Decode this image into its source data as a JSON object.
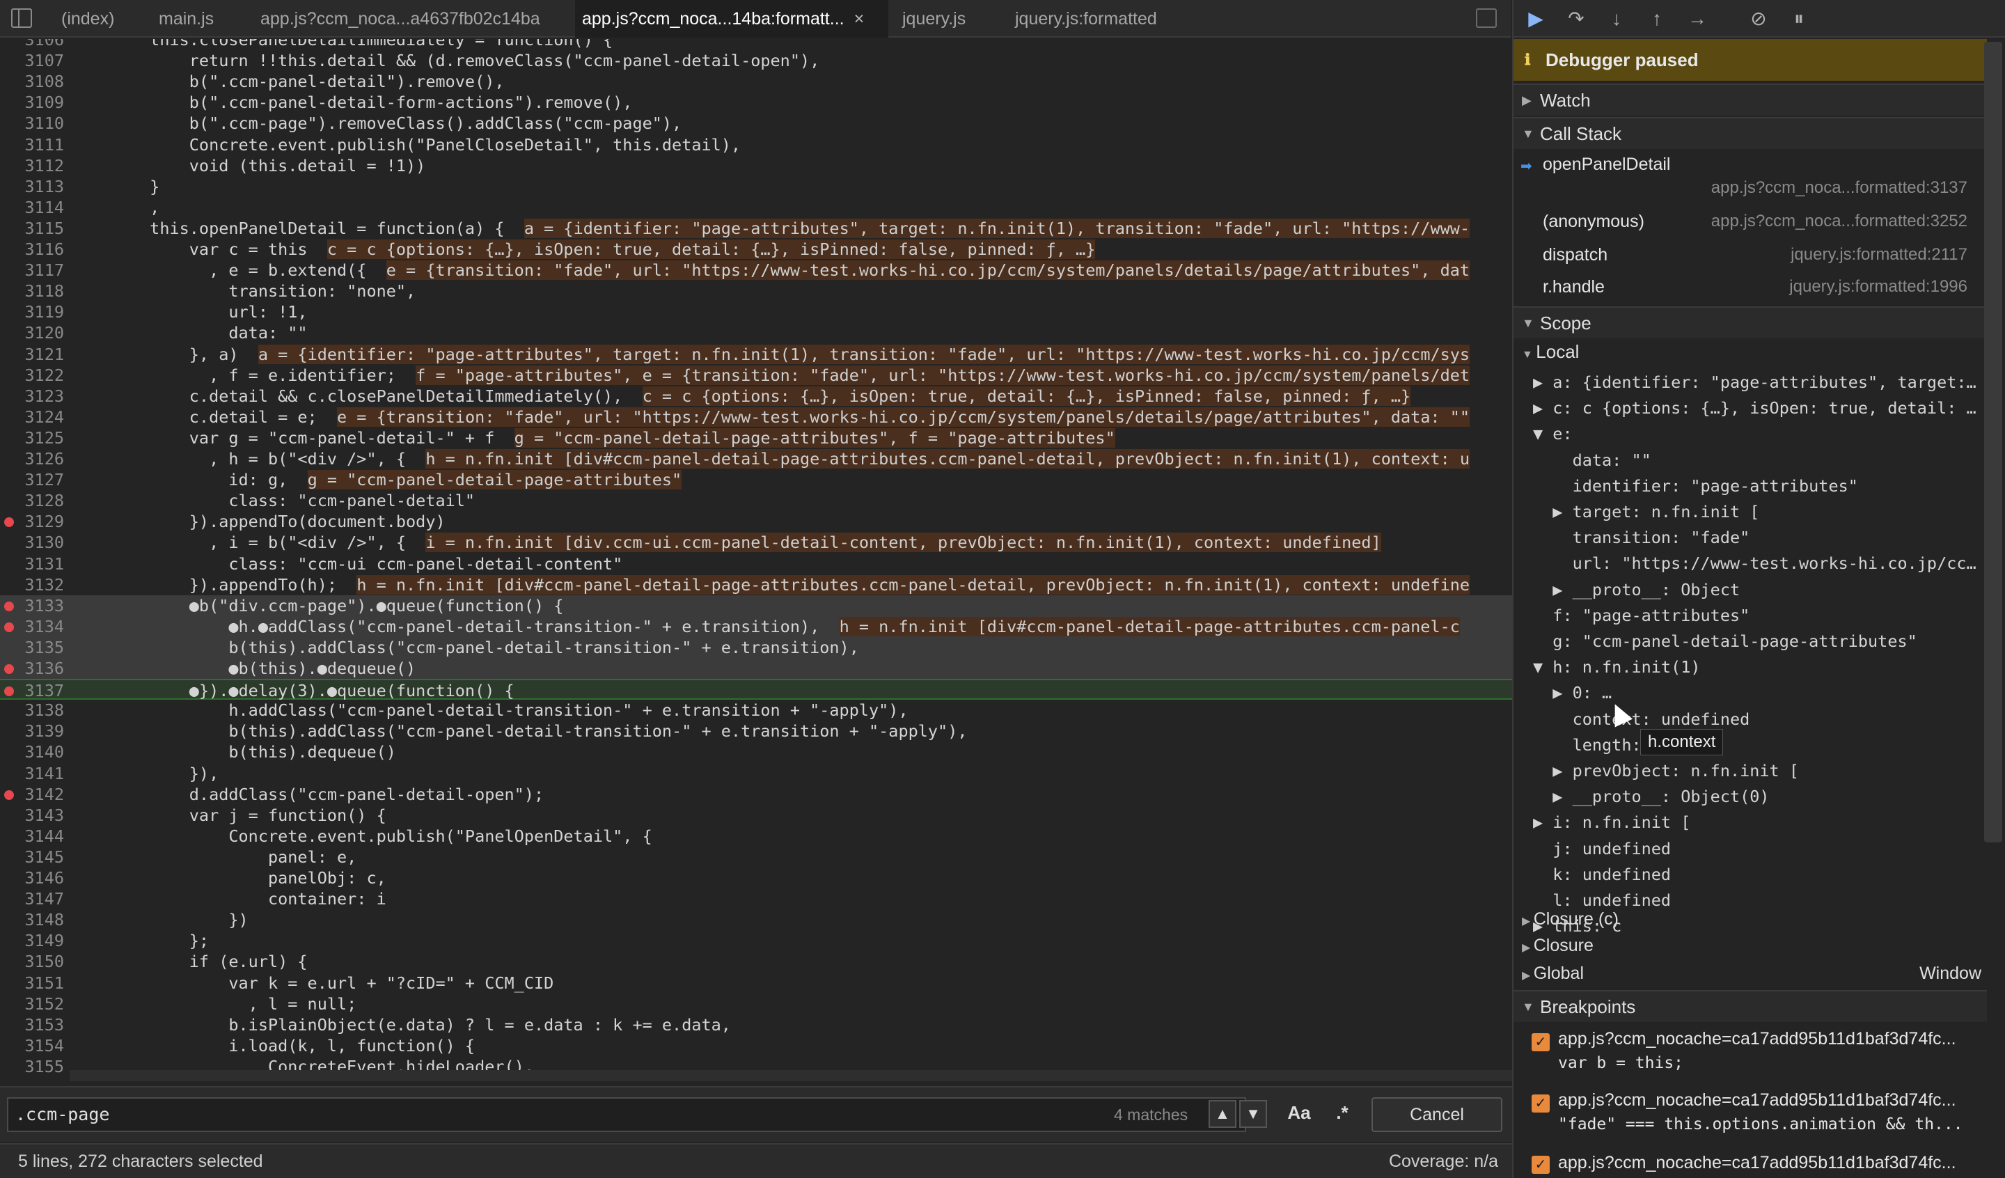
{
  "tabs": [
    "(index)",
    "main.js",
    "app.js?ccm_noca...a4637fb02c14ba",
    "app.js?ccm_noca...14ba:formatt...",
    "jquery.js",
    "jquery.js:formatted"
  ],
  "tab_close_glyph": "×",
  "code_lines": [
    {
      "n": "3106",
      "code": "        this.closePanelDetailImmediately = function() {"
    },
    {
      "n": "3107",
      "code": "            return !!this.detail && (d.removeClass(\"ccm-panel-detail-open\"),"
    },
    {
      "n": "3108",
      "code": "            b(\".ccm-panel-detail\").remove(),"
    },
    {
      "n": "3109",
      "code": "            b(\".ccm-panel-detail-form-actions\").remove(),"
    },
    {
      "n": "3110",
      "code": "            b(\".ccm-page\").removeClass().addClass(\"ccm-page\"),"
    },
    {
      "n": "3111",
      "code": "            Concrete.event.publish(\"PanelCloseDetail\", this.detail),"
    },
    {
      "n": "3112",
      "code": "            void (this.detail = !1))"
    },
    {
      "n": "3113",
      "code": "        }"
    },
    {
      "n": "3114",
      "code": "        ,"
    },
    {
      "n": "3115",
      "code": "        this.openPanelDetail = function(a) {",
      "inline": "a = {identifier: \"page-attributes\", target: n.fn.init(1), transition: \"fade\", url: \"https://www-"
    },
    {
      "n": "3116",
      "code": "            var c = this",
      "inline": "c = c {options: {…}, isOpen: true, detail: {…}, isPinned: false, pinned: ƒ, …}"
    },
    {
      "n": "3117",
      "code": "              , e = b.extend({",
      "inline": "e = {transition: \"fade\", url: \"https://www-test.works-hi.co.jp/ccm/system/panels/details/page/attributes\", dat"
    },
    {
      "n": "3118",
      "code": "                transition: \"none\","
    },
    {
      "n": "3119",
      "code": "                url: !1,"
    },
    {
      "n": "3120",
      "code": "                data: \"\""
    },
    {
      "n": "3121",
      "code": "            }, a)",
      "inline": "a = {identifier: \"page-attributes\", target: n.fn.init(1), transition: \"fade\", url: \"https://www-test.works-hi.co.jp/ccm/sys"
    },
    {
      "n": "3122",
      "code": "              , f = e.identifier;",
      "inline": "f = \"page-attributes\", e = {transition: \"fade\", url: \"https://www-test.works-hi.co.jp/ccm/system/panels/det"
    },
    {
      "n": "3123",
      "code": "            c.detail && c.closePanelDetailImmediately(),",
      "inline": "c = c {options: {…}, isOpen: true, detail: {…}, isPinned: false, pinned: ƒ, …}"
    },
    {
      "n": "3124",
      "code": "            c.detail = e;",
      "inline": "e = {transition: \"fade\", url: \"https://www-test.works-hi.co.jp/ccm/system/panels/details/page/attributes\", data: \"\""
    },
    {
      "n": "3125",
      "code": "            var g = \"ccm-panel-detail-\" + f",
      "inline": "g = \"ccm-panel-detail-page-attributes\", f = \"page-attributes\""
    },
    {
      "n": "3126",
      "code": "              , h = b(\"<div />\", {",
      "inline": "h = n.fn.init [div#ccm-panel-detail-page-attributes.ccm-panel-detail, prevObject: n.fn.init(1), context: u"
    },
    {
      "n": "3127",
      "code": "                id: g,",
      "inline": "g = \"ccm-panel-detail-page-attributes\""
    },
    {
      "n": "3128",
      "code": "                class: \"ccm-panel-detail\""
    },
    {
      "n": "3129",
      "code": "            }).appendTo(document.body)",
      "bp": true
    },
    {
      "n": "3130",
      "code": "              , i = b(\"<div />\", {",
      "inline": "i = n.fn.init [div.ccm-ui.ccm-panel-detail-content, prevObject: n.fn.init(1), context: undefined]"
    },
    {
      "n": "3131",
      "code": "                class: \"ccm-ui ccm-panel-detail-content\""
    },
    {
      "n": "3132",
      "code": "            }).appendTo(h);",
      "inline": "h = n.fn.init [div#ccm-panel-detail-page-attributes.ccm-panel-detail, prevObject: n.fn.init(1), context: undefine"
    },
    {
      "n": "3133",
      "code": "            ●b(\"div.ccm-page\").●queue(function() {",
      "bp": true,
      "sel": true
    },
    {
      "n": "3134",
      "code": "                ●h.●addClass(\"ccm-panel-detail-transition-\" + e.transition),",
      "inline": "h = n.fn.init [div#ccm-panel-detail-page-attributes.ccm-panel-c",
      "bp": true,
      "sel": true
    },
    {
      "n": "3135",
      "code": "                b(this).addClass(\"ccm-panel-detail-transition-\" + e.transition),",
      "sel": true
    },
    {
      "n": "3136",
      "code": "                ●b(this).●dequeue()",
      "bp": true,
      "sel": true
    },
    {
      "n": "3137",
      "code": "            ●}).●delay(3).●queue(function() {",
      "bp": true,
      "cur": true
    },
    {
      "n": "3138",
      "code": "                h.addClass(\"ccm-panel-detail-transition-\" + e.transition + \"-apply\"),"
    },
    {
      "n": "3139",
      "code": "                b(this).addClass(\"ccm-panel-detail-transition-\" + e.transition + \"-apply\"),"
    },
    {
      "n": "3140",
      "code": "                b(this).dequeue()"
    },
    {
      "n": "3141",
      "code": "            }),"
    },
    {
      "n": "3142",
      "code": "            d.addClass(\"ccm-panel-detail-open\");",
      "bp": true
    },
    {
      "n": "3143",
      "code": "            var j = function() {"
    },
    {
      "n": "3144",
      "code": "                Concrete.event.publish(\"PanelOpenDetail\", {"
    },
    {
      "n": "3145",
      "code": "                    panel: e,"
    },
    {
      "n": "3146",
      "code": "                    panelObj: c,"
    },
    {
      "n": "3147",
      "code": "                    container: i"
    },
    {
      "n": "3148",
      "code": "                })"
    },
    {
      "n": "3149",
      "code": "            };"
    },
    {
      "n": "3150",
      "code": "            if (e.url) {"
    },
    {
      "n": "3151",
      "code": "                var k = e.url + \"?cID=\" + CCM_CID"
    },
    {
      "n": "3152",
      "code": "                  , l = null;"
    },
    {
      "n": "3153",
      "code": "                b.isPlainObject(e.data) ? l = e.data : k += e.data,"
    },
    {
      "n": "3154",
      "code": "                i.load(k, l, function() {"
    },
    {
      "n": "3155",
      "code": "                    ConcreteEvent.hideLoader(),"
    }
  ],
  "search": {
    "value": ".ccm-page",
    "matches": "4 matches",
    "case_label": "Aa",
    "regex_label": ".*",
    "cancel": "Cancel"
  },
  "status": {
    "selection": "5 lines, 272 characters selected",
    "coverage": "Coverage: n/a"
  },
  "debugger": {
    "paused": "Debugger paused",
    "watch": "Watch",
    "call_stack": "Call Stack",
    "frames": [
      {
        "name": "openPanelDetail",
        "loc": "app.js?ccm_noca...formatted:3137"
      },
      {
        "name": "(anonymous)",
        "loc": "app.js?ccm_noca...formatted:3252"
      },
      {
        "name": "dispatch",
        "loc": "jquery.js:formatted:2117"
      },
      {
        "name": "r.handle",
        "loc": "jquery.js:formatted:1996"
      }
    ],
    "scope": "Scope",
    "local": "Local",
    "scope_lines": [
      "▶ a: {identifier: \"page-attributes\", target:…",
      "▶ c: c {options: {…}, isOpen: true, detail: …",
      "▼ e:",
      "    data: \"\"",
      "    identifier: \"page-attributes\"",
      "  ▶ target: n.fn.init [",
      "    transition: \"fade\"",
      "    url: \"https://www-test.works-hi.co.jp/cc…",
      "  ▶ __proto__: Object",
      "  f: \"page-attributes\"",
      "  g: \"ccm-panel-detail-page-attributes\"",
      "▼ h: n.fn.init(1)",
      "  ▶ 0: …",
      "    context: undefined",
      "    length: 1",
      "  ▶ prevObject: n.fn.init [",
      "  ▶ __proto__: Object(0)",
      "▶ i: n.fn.init [",
      "  j: undefined",
      "  k: undefined",
      "  l: undefined",
      "▶ this: c"
    ],
    "closure_c": "Closure (c)",
    "closure": "Closure",
    "global": "Global",
    "global_value": "Window",
    "breakpoints": "Breakpoints",
    "bp_items": [
      {
        "file": "app.js?ccm_nocache=ca17add95b11d1baf3d74fc...",
        "code": "var b = this;"
      },
      {
        "file": "app.js?ccm_nocache=ca17add95b11d1baf3d74fc...",
        "code": "\"fade\" === this.options.animation && th..."
      },
      {
        "file": "app.js?ccm_nocache=ca17add95b11d1baf3d74fc...",
        "code": ""
      }
    ],
    "tooltip": "h.context"
  },
  "colors": {
    "accent": "#8ab4f8",
    "breakpoint": "#e5484d",
    "paused_banner": "#5a4a12",
    "checkbox": "#e8893c"
  }
}
